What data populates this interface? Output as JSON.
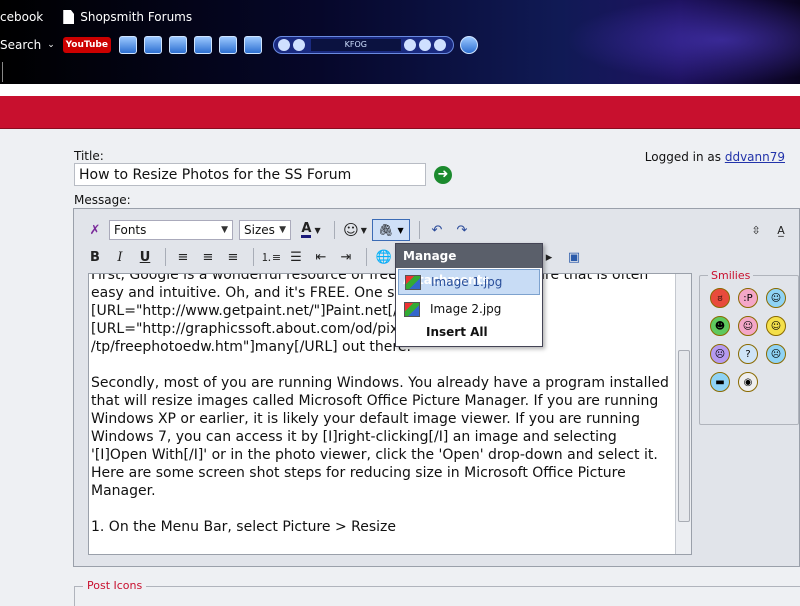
{
  "browser": {
    "bookmarks": [
      "cebook",
      "Shopsmith Forums"
    ],
    "search_label": "Search",
    "youtube_label": "YouTube",
    "radio_station": "KFOG"
  },
  "form": {
    "title_label": "Title:",
    "title_value": "How to Resize Photos for the SS Forum",
    "logged_in_prefix": "Logged in as",
    "username": "ddvann79",
    "message_label": "Message:"
  },
  "toolbar": {
    "font_select": "Fonts",
    "size_select": "Sizes",
    "bold": "B",
    "italic": "I",
    "underline": "U",
    "font_color": "A"
  },
  "message": {
    "paragraphs": [
      "First, Google is a wonderful resource of free photo editing software that is often easy and intuitive.  Oh, and it's FREE.  One such program is [URL=\"http://www.getpaint.net/\"]Paint.net[/URL].  There are [URL=\"http://graphicssoft.about.com/od/pixelbasedfreewin /tp/freephotoedw.htm\"]many[/URL] out there.",
      "Secondly, most of you are running Windows.  You already have a program installed that will resize images called Microsoft Office Picture Manager.  If you are running Windows XP or earlier, it is likely your default image viewer.  If you are running Windows 7, you can access it by [I]right-clicking[/I] an image and selecting '[I]Open With[/I]' or in the photo viewer, click the 'Open' drop-down and select it.  Here are some screen shot steps for reducing size in Microsoft Office Picture Manager.",
      "1.  On the Menu Bar, select Picture > Resize"
    ]
  },
  "attachments_menu": {
    "header": "Manage Attachments",
    "items": [
      "Image 1.jpg",
      "Image 2.jpg"
    ],
    "insert_all": "Insert All"
  },
  "smilies": {
    "legend": "Smilies",
    "items": [
      "mad",
      "tongue",
      "cool",
      "grin",
      "wink",
      "smile",
      "confused",
      "huh",
      "frown",
      "shades",
      "rolleyes"
    ]
  },
  "post_icons": {
    "legend": "Post Icons"
  }
}
